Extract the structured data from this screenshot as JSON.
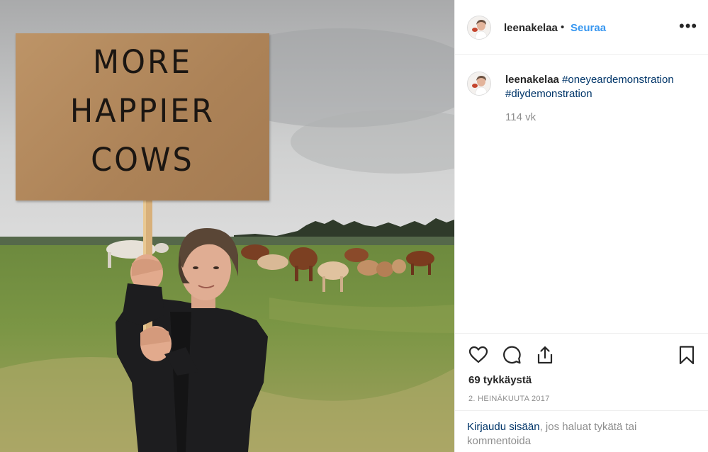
{
  "post": {
    "sign": {
      "line1": "MORE",
      "line2": "HAPPIER",
      "line3": "COWS"
    }
  },
  "header": {
    "username": "leenakelaa",
    "separator": "•",
    "follow_label": "Seuraa",
    "more_label": "•••"
  },
  "caption": {
    "username": "leenakelaa",
    "hashtag1": "#oneyeardemonstration",
    "hashtag2": "#diydemonstration",
    "time_ago": "114 vk"
  },
  "actions": {
    "icons": [
      "heart-icon",
      "comment-icon",
      "share-icon",
      "bookmark-icon"
    ],
    "likes": "69 tykkäystä",
    "date": "2. HEINÄKUUTA 2017"
  },
  "login": {
    "link_text": "Kirjaudu sisään",
    "rest_text": ", jos haluat tykätä tai kommentoida"
  },
  "colors": {
    "follow": "#3897f0",
    "link": "#003569",
    "muted": "#8e8e8e",
    "border": "#efefef"
  }
}
